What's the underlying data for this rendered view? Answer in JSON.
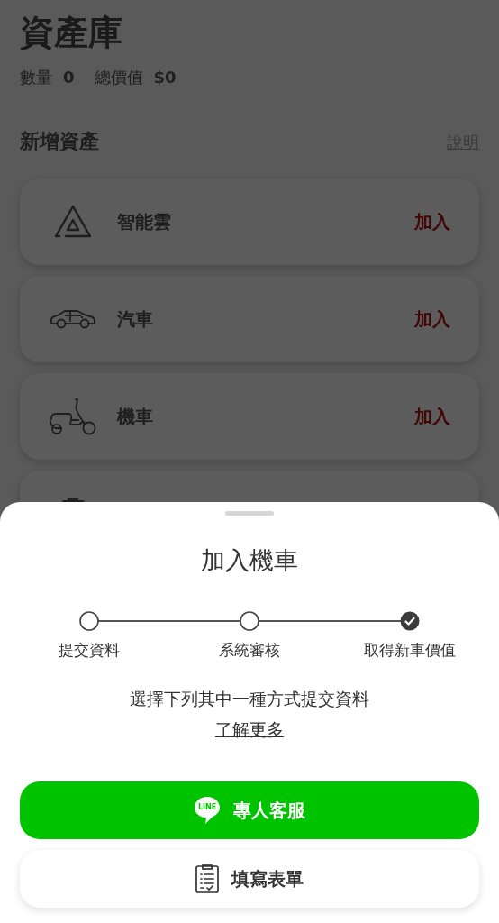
{
  "header": {
    "title": "資產庫",
    "stats": [
      {
        "label": "數量",
        "value": "0"
      },
      {
        "label": "總價值",
        "value": "$0"
      }
    ]
  },
  "section": {
    "title": "新增資產",
    "help_link": "說明"
  },
  "assets": [
    {
      "name": "智能雲",
      "action": "加入"
    },
    {
      "name": "汽車",
      "action": "加入"
    },
    {
      "name": "機車",
      "action": "加入"
    }
  ],
  "sheet": {
    "title": "加入機車",
    "steps": [
      {
        "label": "提交資料",
        "done": false
      },
      {
        "label": "系統審核",
        "done": false
      },
      {
        "label": "取得新車價值",
        "done": true
      }
    ],
    "instruction": "選擇下列其中一種方式提交資料",
    "learn_more": "了解更多",
    "buttons": [
      {
        "kind": "line",
        "icon_text": "LINE",
        "label": "專人客服"
      },
      {
        "kind": "form",
        "label": "填寫表單"
      }
    ]
  }
}
